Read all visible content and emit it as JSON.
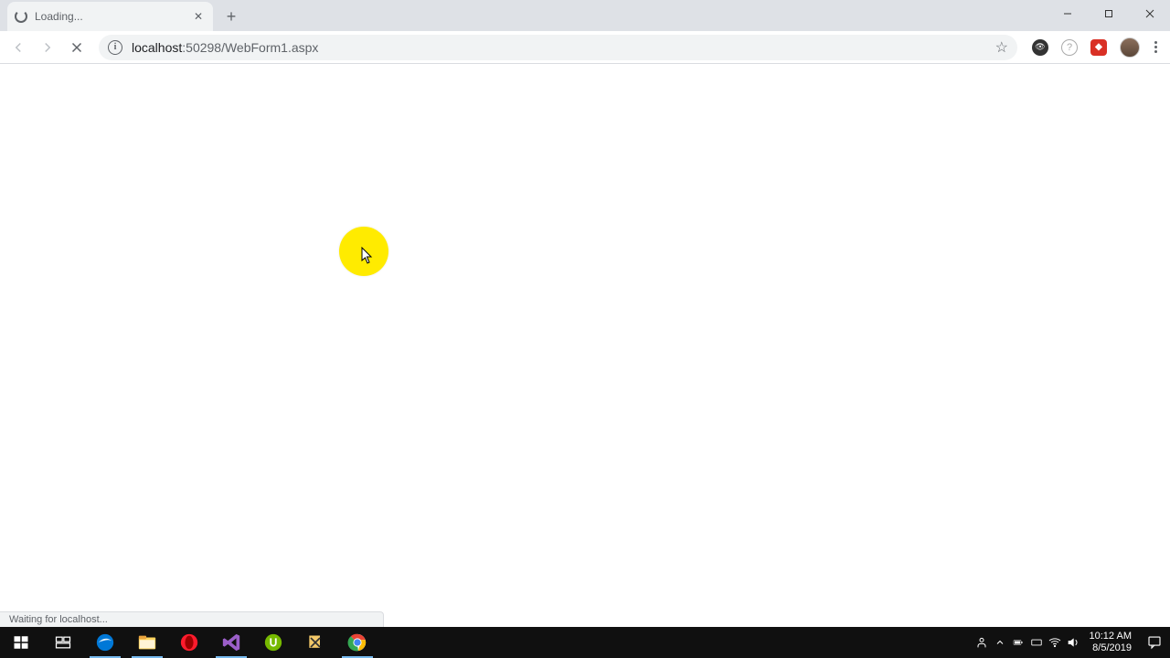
{
  "tab": {
    "title": "Loading..."
  },
  "address": {
    "host": "localhost",
    "port_path": ":50298/WebForm1.aspx"
  },
  "status_bar": "Waiting for localhost...",
  "clock": {
    "time": "10:12 AM",
    "date": "8/5/2019"
  }
}
